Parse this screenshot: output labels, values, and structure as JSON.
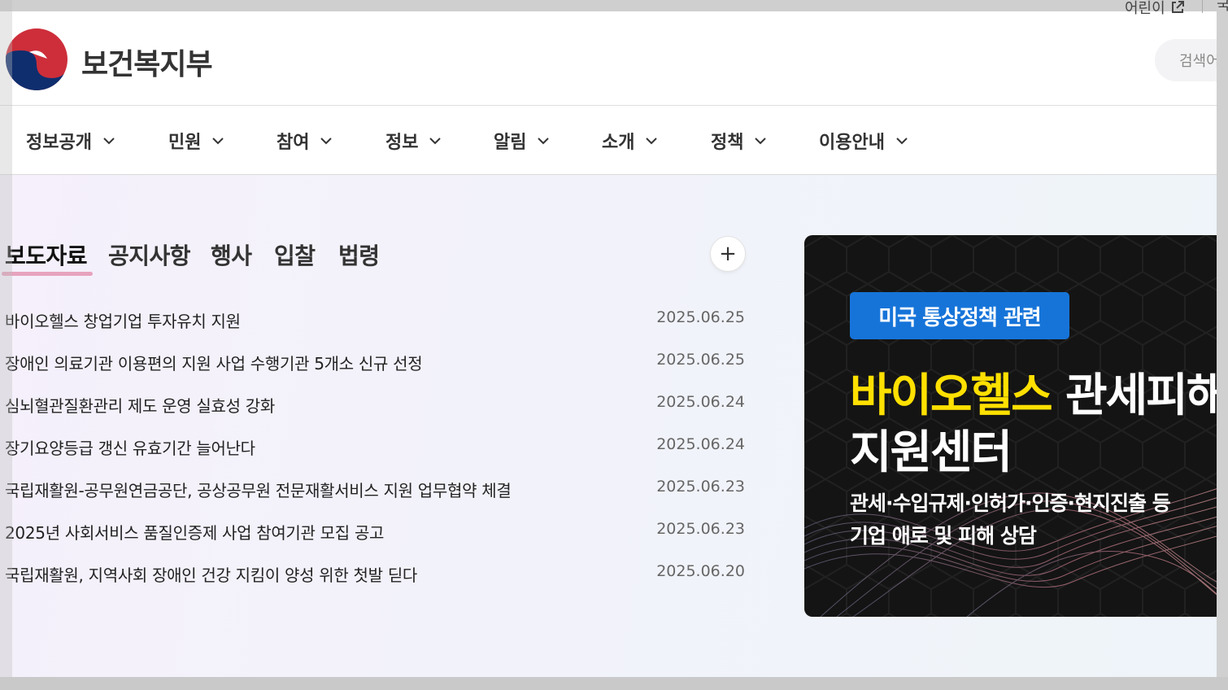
{
  "utility": {
    "kids_link": "어린이",
    "more": "국"
  },
  "header": {
    "logo_text": "보건복지부",
    "search_placeholder": "검색어를"
  },
  "gnb": {
    "items": [
      "정보공개",
      "민원",
      "참여",
      "정보",
      "알림",
      "소개",
      "정책",
      "이용안내"
    ]
  },
  "news": {
    "tabs": [
      "보도자료",
      "공지사항",
      "행사",
      "입찰",
      "법령"
    ],
    "more_label": "+",
    "items": [
      {
        "title": "바이오헬스 창업기업 투자유치 지원",
        "date": "2025.06.25"
      },
      {
        "title": "장애인 의료기관 이용편의 지원 사업 수행기관 5개소 신규 선정",
        "date": "2025.06.25"
      },
      {
        "title": "심뇌혈관질환관리 제도 운영 실효성 강화",
        "date": "2025.06.24"
      },
      {
        "title": "장기요양등급 갱신 유효기간 늘어난다",
        "date": "2025.06.24"
      },
      {
        "title": "국립재활원-공무원연금공단, 공상공무원 전문재활서비스 지원 업무협약 체결",
        "date": "2025.06.23"
      },
      {
        "title": "2025년 사회서비스 품질인증제 사업 참여기관 모집 공고",
        "date": "2025.06.23"
      },
      {
        "title": "국립재활원, 지역사회 장애인 건강 지킴이 양성 위한 첫발 딛다",
        "date": "2025.06.20"
      }
    ]
  },
  "banner": {
    "tag": "미국 통상정책 관련",
    "line1_highlight": "바이오헬스",
    "line1_rest": "관세피해",
    "line2": "지원센터",
    "desc1": "관세·수입규제·인허가·인증·현지진출 등",
    "desc2": "기업 애로 및 피해 상담",
    "colors": {
      "tag_bg": "#1674d9",
      "highlight": "#ffe000",
      "background": "#141414"
    }
  },
  "colors": {
    "tab_underline": "#e7a3bd",
    "logo_red": "#cd2e3a",
    "logo_blue": "#0f2e6e"
  }
}
